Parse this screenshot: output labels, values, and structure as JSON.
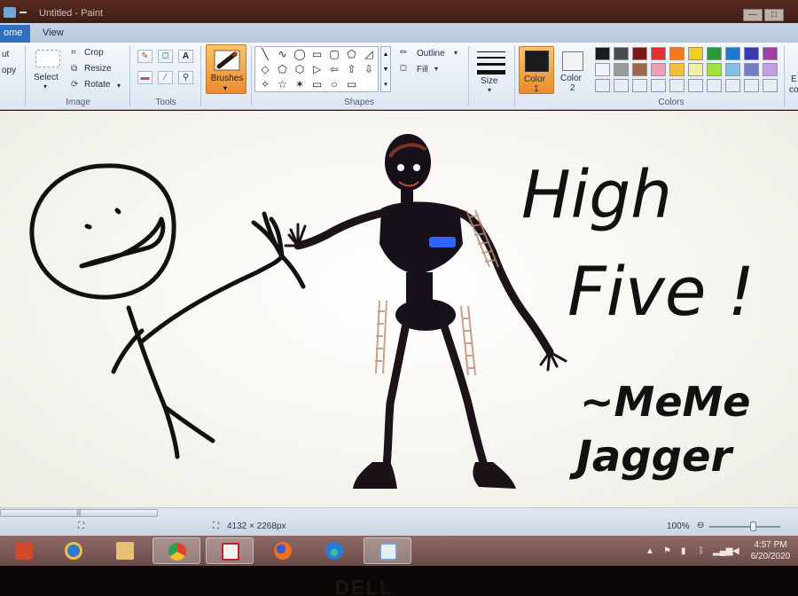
{
  "window": {
    "title": "Untitled - Paint",
    "minimize_symbol": "—",
    "maximize_symbol": "□"
  },
  "tabs": [
    {
      "label": "Home",
      "visible_text": "ome",
      "active": true
    },
    {
      "label": "View",
      "active": false
    }
  ],
  "ribbon": {
    "clipboard": {
      "cut_label": "ut",
      "copy_label": "opy"
    },
    "image": {
      "select_label": "Select",
      "crop_label": "Crop",
      "resize_label": "Resize",
      "rotate_label": "Rotate",
      "group_label": "Image"
    },
    "tools": {
      "group_label": "Tools",
      "items": [
        "pencil-icon",
        "fill-icon",
        "text-icon",
        "eraser-icon",
        "color-picker-icon",
        "magnifier-icon"
      ],
      "text_glyph": "A"
    },
    "brushes": {
      "label": "Brushes"
    },
    "shapes": {
      "group_label": "Shapes",
      "outline_label": "Outline",
      "fill_label": "Fill",
      "glyphs": [
        "╲",
        "∿",
        "◯",
        "▭",
        "▢",
        "⬠",
        "◿",
        "◇",
        "⬠",
        "⬡",
        "▷",
        "⇦",
        "⇧",
        "⇩",
        "✧",
        "☆",
        "✶",
        "▭",
        "○",
        "▭"
      ]
    },
    "size": {
      "label": "Size"
    },
    "color1": {
      "label_line1": "Color",
      "label_line2": "1",
      "value": "#1c1c1c"
    },
    "color2": {
      "label_line1": "Color",
      "label_line2": "2",
      "value": "#f2f2f2"
    },
    "colors": {
      "group_label": "Colors",
      "edit_label": "E",
      "edit_label2": "co",
      "row1": [
        "#1a1a1a",
        "#4a4a4a",
        "#7a1a1a",
        "#e03030",
        "#f07a20",
        "#f0d020",
        "#2a9a3a",
        "#1a7ad0",
        "#3a3ab0",
        "#a040a0"
      ],
      "row2": [
        "#f2f2f2",
        "#9a9a9a",
        "#9a6a4a",
        "#f0a0b0",
        "#f0c040",
        "#f0f0a0",
        "#a0e040",
        "#80c0e0",
        "#7080c0",
        "#c0a0e0"
      ],
      "row3": [
        "#e8eef6",
        "#e8eef6",
        "#e8eef6",
        "#e8eef6",
        "#e8eef6",
        "#e8eef6",
        "#e8eef6",
        "#e8eef6",
        "#e8eef6",
        "#e8eef6"
      ]
    }
  },
  "canvas": {
    "text_line1": "High",
    "text_line2": "Five !",
    "text_line3": "~MeMe",
    "text_line4": "Jagger"
  },
  "statusbar": {
    "dimensions": "4132 × 2268px",
    "zoom": "100%"
  },
  "taskbar": {
    "apps": [
      "windows-media-center",
      "internet-explorer",
      "file-explorer",
      "chrome",
      "adobe-reader",
      "firefox",
      "edge",
      "paint"
    ],
    "active_app": "paint"
  },
  "clock": {
    "time": "4:57 PM",
    "date": "6/20/2020"
  },
  "monitor": {
    "brand": "DELL"
  }
}
